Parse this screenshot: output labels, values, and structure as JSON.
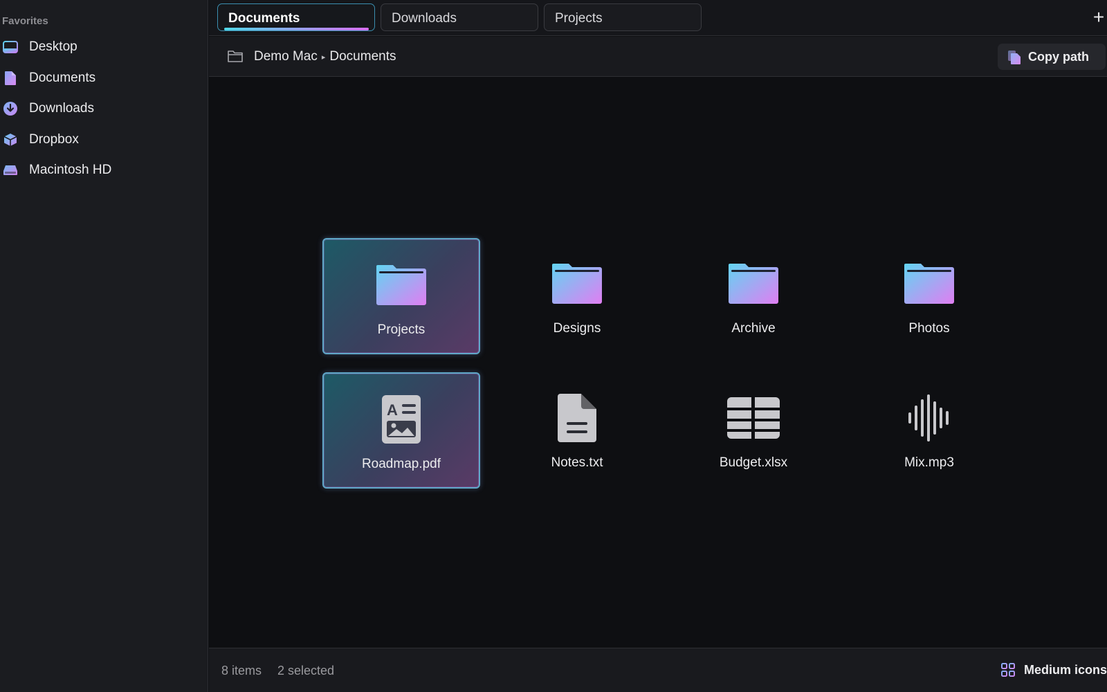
{
  "sidebar": {
    "heading": "Favorites",
    "items": [
      {
        "label": "Desktop",
        "icon": "desktop-icon"
      },
      {
        "label": "Documents",
        "icon": "document-icon"
      },
      {
        "label": "Downloads",
        "icon": "download-icon"
      },
      {
        "label": "Dropbox",
        "icon": "dropbox-icon"
      },
      {
        "label": "Macintosh HD",
        "icon": "hard-drive-icon"
      }
    ]
  },
  "tabs": [
    {
      "label": "Documents",
      "active": true
    },
    {
      "label": "Downloads",
      "active": false
    },
    {
      "label": "Projects",
      "active": false
    }
  ],
  "new_tab_label": "+",
  "breadcrumb": {
    "root": "Demo Mac",
    "separator": "▸",
    "current": "Documents"
  },
  "copy_path_label": "Copy path",
  "files": [
    {
      "name": "Projects",
      "type": "folder",
      "selected": true
    },
    {
      "name": "Designs",
      "type": "folder",
      "selected": false
    },
    {
      "name": "Archive",
      "type": "folder",
      "selected": false
    },
    {
      "name": "Photos",
      "type": "folder",
      "selected": false
    },
    {
      "name": "Roadmap.pdf",
      "type": "pdf",
      "selected": true
    },
    {
      "name": "Notes.txt",
      "type": "text",
      "selected": false
    },
    {
      "name": "Budget.xlsx",
      "type": "spreadsheet",
      "selected": false
    },
    {
      "name": "Mix.mp3",
      "type": "audio",
      "selected": false
    }
  ],
  "status": {
    "count": "8 items",
    "selected": "2 selected"
  },
  "view_mode_label": "Medium icons",
  "colors": {
    "accent_cyan": "#4fd8e8",
    "accent_purple": "#d86ef2",
    "background": "#0e0f12",
    "sidebar": "#1b1c20"
  }
}
